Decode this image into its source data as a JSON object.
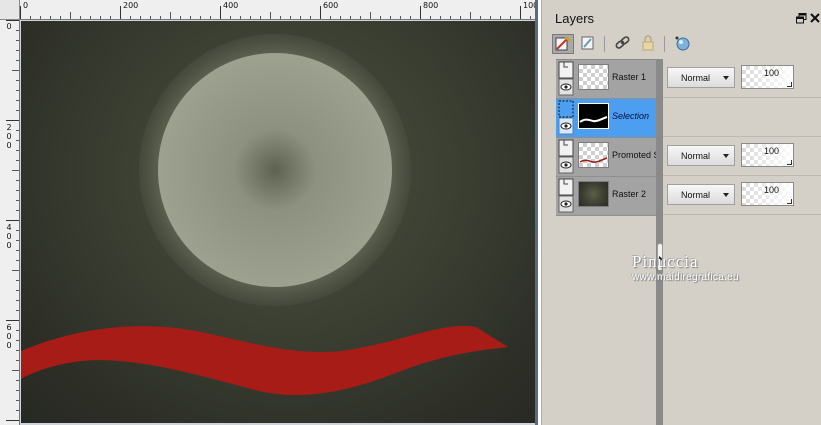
{
  "ruler": {
    "top_labels": [
      "0",
      "200",
      "400",
      "600",
      "800",
      "100"
    ],
    "left_labels": [
      "0",
      "200",
      "400",
      "600"
    ]
  },
  "canvas": {
    "background": "#3a3d30",
    "circle_color": "#9a9e8c",
    "ribbon_color": "#b01e1a"
  },
  "panel": {
    "title": "Layers",
    "icons": [
      "float-window-icon",
      "close-icon"
    ],
    "toolbar": [
      {
        "name": "new-raster-layer-icon",
        "active": true
      },
      {
        "name": "new-vector-layer-icon",
        "active": false
      },
      {
        "name": "link-icon",
        "active": false
      },
      {
        "name": "lock-icon",
        "active": false
      },
      {
        "name": "mask-icon",
        "active": false
      }
    ]
  },
  "layers": [
    {
      "name": "Raster 1",
      "blend": "Normal",
      "opacity": "100",
      "selected": false
    },
    {
      "name": "Selection",
      "blend": "",
      "opacity": "",
      "selected": true
    },
    {
      "name": "Promoted Selection",
      "blend": "Normal",
      "opacity": "100",
      "selected": false
    },
    {
      "name": "Raster 2",
      "blend": "Normal",
      "opacity": "100",
      "selected": false
    }
  ],
  "watermark": {
    "title": "Pinuccia",
    "url": "www.maidiregrafica.eu"
  },
  "colors": {
    "selection_highlight": "#4c9ff0",
    "panel_bg": "#d4d0c8"
  }
}
